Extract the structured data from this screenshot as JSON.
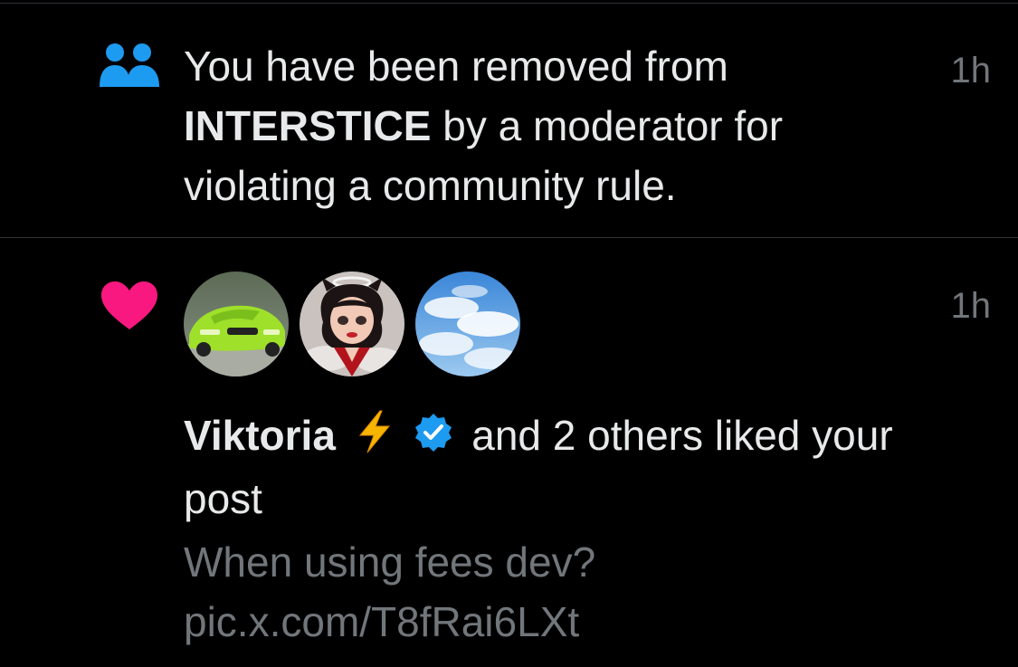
{
  "notifications": [
    {
      "type": "community",
      "icon": "community-icon",
      "icon_color": "#1d9bf0",
      "text_before": "You have been removed from ",
      "community_name": "INTERSTICE",
      "text_after": " by a moderator for violating a community rule.",
      "time": "1h"
    },
    {
      "type": "like",
      "icon": "heart-icon",
      "icon_color": "#f91880",
      "avatars": [
        "green-car-avatar",
        "cartoon-girl-avatar",
        "sky-clouds-avatar"
      ],
      "user_name": "Viktoria",
      "user_emoji": "⚡",
      "verified": true,
      "verified_color": "#1d9bf0",
      "action_text": " and 2 others liked your post",
      "post_preview": "When using fees dev? pic.x.com/T8fRai6LXt",
      "time": "1h"
    }
  ]
}
